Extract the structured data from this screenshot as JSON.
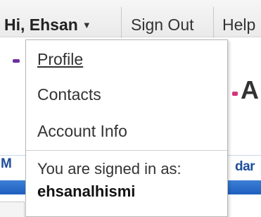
{
  "header": {
    "greeting": "Hi, Ehsan",
    "caret_icon": "chevron-down-icon",
    "sign_out": "Sign Out",
    "help": "Help"
  },
  "menu": {
    "items": [
      {
        "label": "Profile"
      },
      {
        "label": "Contacts"
      },
      {
        "label": "Account Info"
      }
    ],
    "signed_in_label": "You are signed in as:",
    "username": "ehsanalhismi"
  },
  "background": {
    "partial_letter": "A",
    "left_fragment": "M",
    "right_fragment": "dar"
  },
  "colors": {
    "menu_border": "#b7b7b7",
    "link_blue": "#1d4e9a",
    "bar_blue": "#1e5fbf",
    "text": "#333333"
  }
}
